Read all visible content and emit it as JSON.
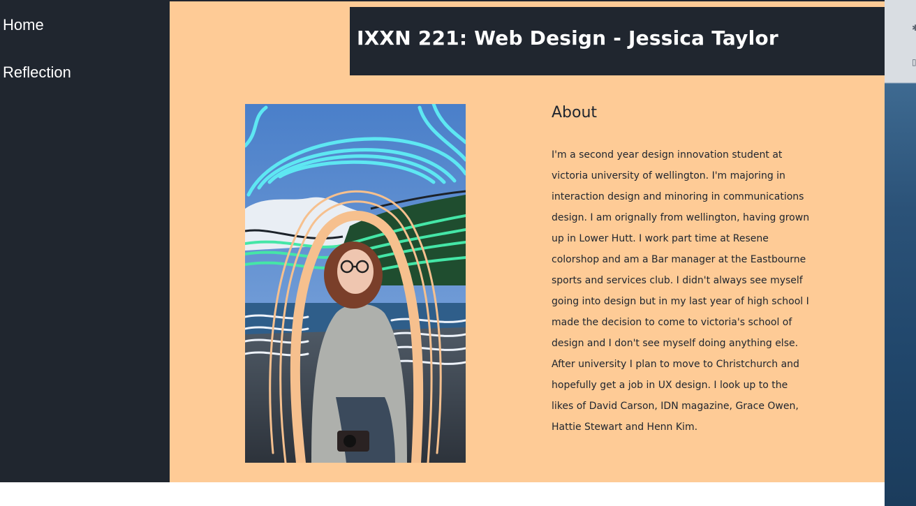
{
  "sidebar": {
    "items": [
      {
        "label": "Home"
      },
      {
        "label": "Reflection"
      }
    ]
  },
  "header": {
    "title": "IXXN 221: Web Design - Jessica Taylor"
  },
  "about": {
    "heading": "About",
    "text": "I'm a second year design innovation student at victoria university of wellington. I'm majoring in interaction design and minoring in communications design. I am orignally from wellington, having grown up in Lower Hutt. I work part time at Resene colorshop and am a Bar manager at the Eastbourne sports and services club. I didn't always see myself going into design but in my last year of high school I made the decision to come to victoria's school of design and I don't see myself doing anything else. After university I plan to move to Christchurch and hopefully get a job in UX design. I look up to the likes of David Carson, IDN magazine, Grace Owen, Hattie Stewart and Henn Kim."
  },
  "colors": {
    "sidebar_bg": "#20262f",
    "main_bg": "#fecb96",
    "header_bg": "#20262f",
    "text_dark": "#20262f"
  }
}
